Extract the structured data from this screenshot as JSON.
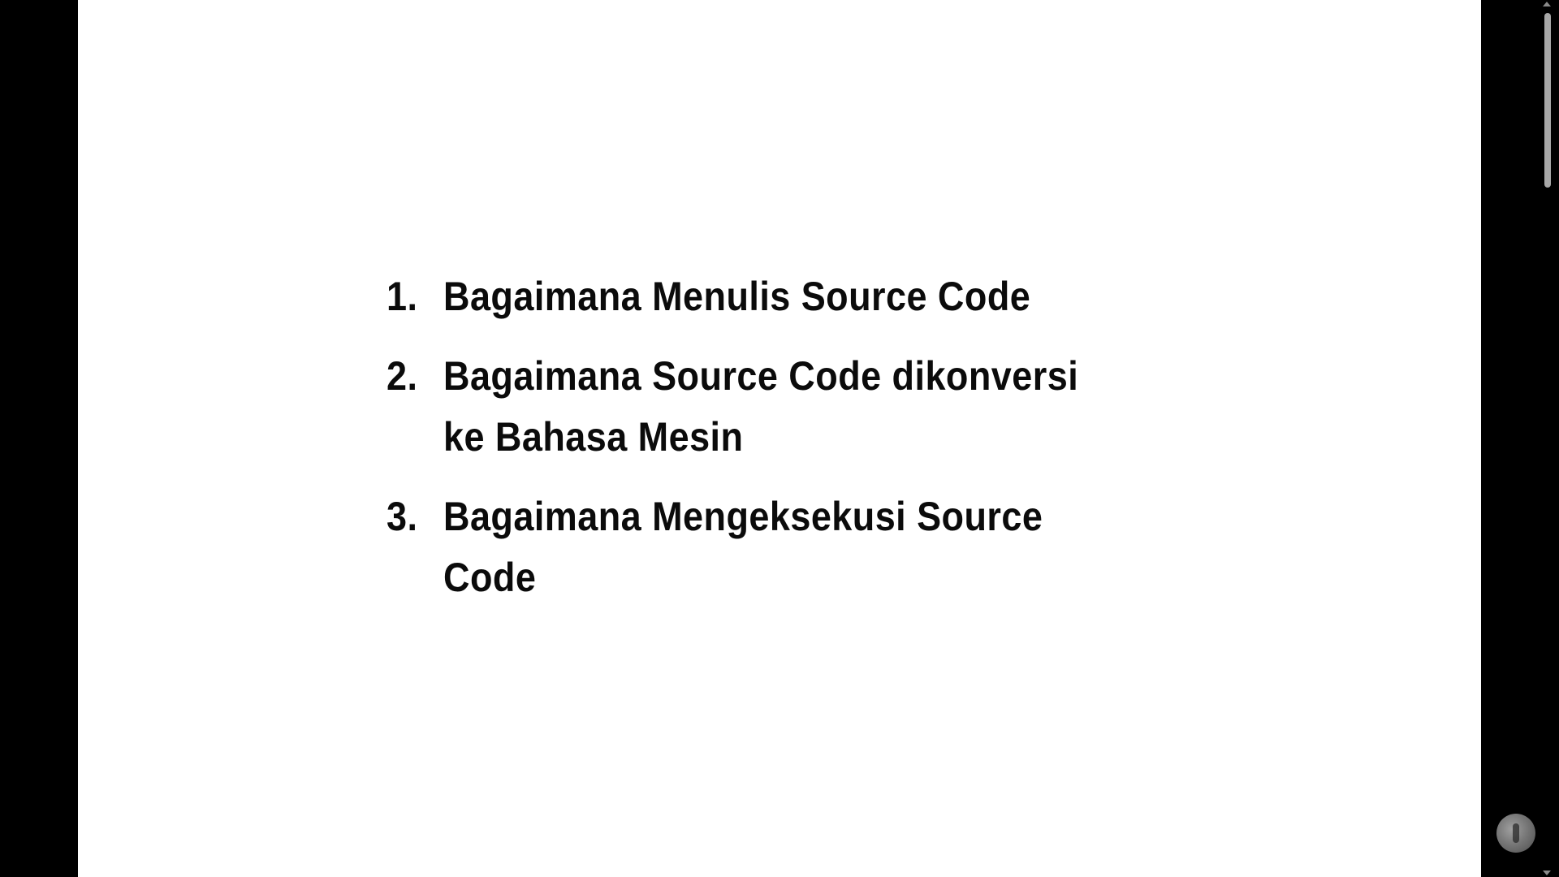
{
  "slide": {
    "items": [
      {
        "number": "1.",
        "text": "Bagaimana Menulis Source Code"
      },
      {
        "number": "2.",
        "text": "Bagaimana Source Code dikonversi\nke Bahasa Mesin"
      },
      {
        "number": "3.",
        "text": "Bagaimana Mengeksekusi Source\nCode"
      }
    ]
  },
  "colors": {
    "background": "#000000",
    "slide": "#ffffff",
    "text": "#0b0b0b",
    "scrollbar": "#a8a8a8"
  },
  "icons": {
    "watermark": "channel-logo-icon",
    "scroll_up": "scroll-up-arrow-icon",
    "scroll_down": "scroll-down-arrow-icon"
  }
}
